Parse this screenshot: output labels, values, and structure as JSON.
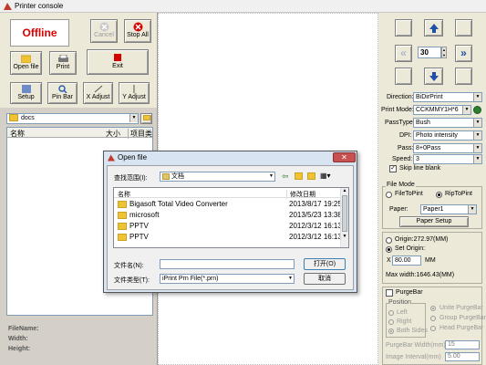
{
  "window": {
    "title": "Printer console"
  },
  "toolbar": {
    "status": "Offline",
    "cancel": "Cancel",
    "stop_all": "Stop All",
    "open_file": "Open file",
    "print": "Print",
    "exit": "Exit",
    "setup": "Setup",
    "pin_bar": "Pin Bar",
    "x_adjust": "X Adjust",
    "y_adjust": "Y Adjust"
  },
  "folder_combo": {
    "value": "docs"
  },
  "file_list": {
    "col_name": "名称",
    "col_size": "大小",
    "col_type": "项目类"
  },
  "file_info": {
    "filename_label": "FileName:",
    "width_label": "Width:",
    "height_label": "Height:"
  },
  "nav": {
    "position_value": "30"
  },
  "settings": {
    "direction_label": "Direction:",
    "direction_value": "BiDirPrint",
    "print_mode_label": "Print Mode:",
    "print_mode_value": "CCKMMY1H*6",
    "pass_type_label": "PassType:",
    "pass_type_value": "Bush",
    "dpi_label": "DPI:",
    "dpi_value": "Photo intensity",
    "pass_label": "Pass:",
    "pass_value": "8+0Pass",
    "speed_label": "Speed:",
    "speed_value": "3",
    "skip_line_blank": "Skip line blank"
  },
  "file_mode": {
    "group_label": "File Mode",
    "file_to_print": "FileToPint",
    "rip_to_print": "RipToPint",
    "paper_label": "Paper:",
    "paper_value": "Paper1",
    "paper_setup": "Paper Setup"
  },
  "origin": {
    "origin_text": "Origin:272.97(MM)",
    "set_origin": "Set Origin:",
    "x_label": "X",
    "x_value": "80.00",
    "x_unit": "MM",
    "max_width": "Max width:1646.43(MM)"
  },
  "purge": {
    "purge_bar": "PurgeBar",
    "position_label": "Position",
    "left": "Left",
    "right": "Right",
    "both_sides": "Both Sides",
    "unite": "Unite PurgeBar",
    "group": "Group PurgeBar",
    "head": "Head PurgeBar",
    "width_label": "PurgeBar Width(mm)",
    "width_value": "15",
    "interval_label": "Image Interval(mm)",
    "interval_value": "5.00"
  },
  "dialog": {
    "title": "Open file",
    "lookin_label": "查找范围(I):",
    "lookin_value": "文档",
    "col_name": "名称",
    "col_date": "修改日期",
    "files": [
      {
        "name": "Bigasoft Total Video Converter",
        "date": "2013/8/17 19:25"
      },
      {
        "name": "microsoft",
        "date": "2013/5/23 13:38"
      },
      {
        "name": "PPTV",
        "date": "2012/3/12 16:13"
      },
      {
        "name": "PPTV",
        "date": "2012/3/12 16:13"
      }
    ],
    "filename_label": "文件名(N):",
    "filename_value": "",
    "filetype_label": "文件类型(T):",
    "filetype_value": "iPrint Prn File(*.prn)",
    "open_button": "打开(O)",
    "cancel_button": "取消"
  }
}
